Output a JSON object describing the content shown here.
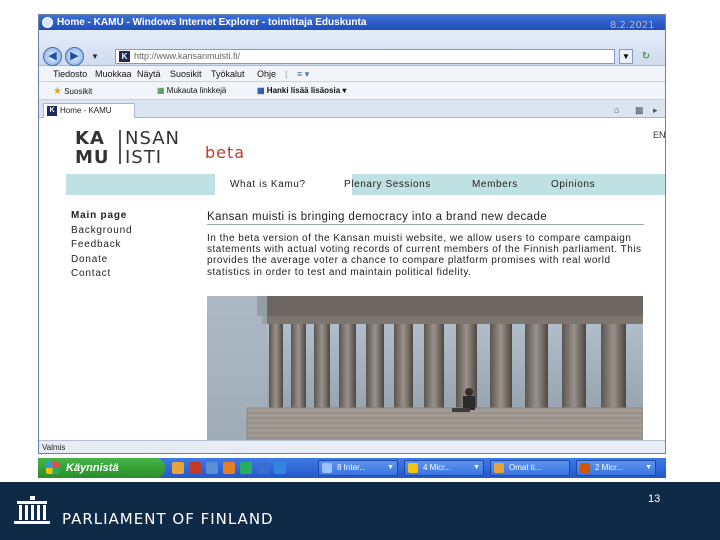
{
  "slide": {
    "date": "8.2.2021",
    "page_number": "13",
    "footer_title": "PARLIAMENT OF FINLAND"
  },
  "browser": {
    "title": "Home - KAMU - Windows Internet Explorer - toimittaja Eduskunta",
    "address": "http://www.kansanmuisti.fi/",
    "menu": [
      "Tiedosto",
      "Muokkaa",
      "Näytä",
      "Suosikit",
      "Työkalut",
      "Ohje"
    ],
    "favorites": {
      "favorites_label": "Suosikit",
      "customize_links_label": "Mukauta linkkejä",
      "hotmail_label": "Hanki lisää lisäosia"
    },
    "tab_label": "Home - KAMU",
    "status": "Valmis"
  },
  "site": {
    "logo": {
      "line1_left": "KA",
      "line1_right": "NSAN",
      "line2_left": "MU",
      "line2_right": "ISTI"
    },
    "beta_label": "beta",
    "lang_link": "EN",
    "nav": [
      "What is Kamu?",
      "Plenary Sessions",
      "Members",
      "Opinions"
    ],
    "side_menu": [
      "Main page",
      "Background",
      "Feedback",
      "Donate",
      "Contact"
    ],
    "headline": "Kansan muisti is bringing democracy into a brand new decade",
    "body": "In the beta version of the Kansan muisti website, we allow users to compare campaign statements with actual voting records of current members of the Finnish parliament. This provides the average voter a chance to compare platform promises with real world statistics in order to test and maintain political fidelity."
  },
  "taskbar": {
    "start_label": "Käynnistä",
    "buttons": [
      "8 Inter...",
      "4 Micr...",
      "Omat ti...",
      "2 Micr..."
    ]
  },
  "colors": {
    "brand_bar": "#0f2a47",
    "nav_strip": "#bfe1e3",
    "beta": "#c0392b",
    "taskbar": "#2457c9",
    "start": "#2a8d2a"
  }
}
